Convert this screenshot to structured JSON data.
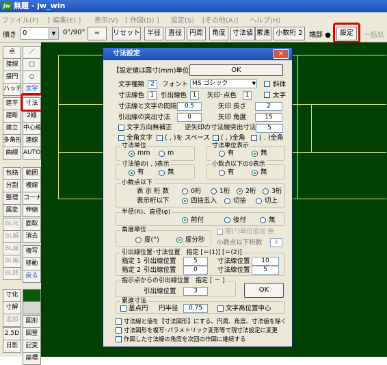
{
  "app": {
    "title": "無題 - jw_win",
    "icon": "jw"
  },
  "menu": [
    "ファイル(F)",
    "[ 編集(E) ]",
    "表示(V)",
    "[ 作図(D) ]",
    "設定(S)",
    "[その他(A)]",
    "ヘルプ(H)"
  ],
  "toolbar": {
    "angle_label": "傾き",
    "angle_value": "0",
    "rot_label": "0°/90°",
    "eq_label": "=",
    "reset": "リセット",
    "radius": "半径",
    "diameter": "直径",
    "circumference": "円周",
    "angle": "角度",
    "dim_value": "寸法値",
    "cumulative": "累進",
    "decimal": "小数桁 2",
    "endpoint": "端部 ●",
    "settings": "設定",
    "batch": "一括処"
  },
  "left_toolbar": {
    "col1": [
      "点",
      "接線",
      "接円",
      "ハッチ",
      "建平",
      "建断",
      "建立",
      "多角形",
      "曲線",
      "包絡",
      "分割",
      "整理",
      "属変",
      "BL化",
      "BL解",
      "BL属",
      "BL編",
      "BL終",
      "寸化",
      "寸解",
      "追加",
      "2.5D",
      "日影"
    ],
    "col2": [
      "／",
      "□",
      "○",
      "文字",
      "寸法",
      "2線",
      "中心線",
      "連線",
      "AUTO",
      "範囲",
      "複線",
      "コーナー",
      "伸縮",
      "面取",
      "消去",
      "複写",
      "移動",
      "戻る",
      "",
      "",
      "図形",
      "図登",
      "記変",
      "座標"
    ]
  },
  "dialog": {
    "title": "寸法設定",
    "close_label": "×",
    "unit_note": "【設定値は図寸(mm)単位】",
    "ok1": "OK",
    "ok2": "OK",
    "font_type_label": "文字種類",
    "font_type_value": "2",
    "font_label": "フォント",
    "font_value": "MS ゴシック",
    "italic_label": "斜体",
    "dim_line_color_label": "寸法線色",
    "dim_line_color_value": "1",
    "leader_color_label": "引出線色",
    "leader_color_value": "1",
    "arrow_color_label": "矢印･点色",
    "arrow_color_value": "1",
    "bold_label": "太字",
    "text_gap_label": "寸法線と文字の間隔",
    "text_gap_value": "0.5",
    "arrow_len_label": "矢印 長さ",
    "arrow_len_value": "2",
    "leader_ext_label": "引出線の突出寸法",
    "leader_ext_value": "0",
    "arrow_angle_label": "矢印 角度",
    "arrow_angle_value": "15",
    "text_dir_label": "文字方向無補正",
    "rev_arrow_label": "逆矢印の寸法線突出寸法",
    "rev_arrow_value": "5",
    "fullwidth_label": "全角文字",
    "comma_space_label": "( , )を スペース",
    "comma_full_label": "( , )全角",
    "dot_full_label": "( . )全角",
    "unit_group": {
      "title": "寸法単位",
      "opt1": "mm",
      "opt2": "m"
    },
    "unit_show_group": {
      "title": "寸法単位表示",
      "opt1": "有",
      "opt2": "無"
    },
    "comma_group": {
      "title": "寸法値の( , )表示",
      "opt1": "有",
      "opt2": "無"
    },
    "zero_group": {
      "title": "小数点以下の0表示",
      "opt1": "有",
      "opt2": "無"
    },
    "decimal_group": {
      "title": "小数点以下",
      "digits_label": "表 示 桁 数",
      "d0": "0桁",
      "d1": "1桁",
      "d2": "2桁",
      "d3": "3桁",
      "round_label": "表示桁以下",
      "r1": "四捨五入",
      "r2": "切捨",
      "r3": "切上"
    },
    "radius_group": {
      "title": "半径(R)、直径(φ)",
      "opt1": "前付",
      "opt2": "後付",
      "opt3": "無"
    },
    "angle_group": {
      "title": "角度単位",
      "opt1": "度(°)",
      "opt2": "度分秒",
      "deg_suffix_label": "度(°)単位追加 無",
      "decimals_label": "小数点以下桁数",
      "decimals_value": "4"
    },
    "pos_group": {
      "title": "引出線位置･寸法位置　指定 [＝(1)] [＝(2)]",
      "s1_label": "指定 1",
      "s2_label": "指定 2",
      "leader_label": "引出線位置",
      "dim_label": "寸法線位置",
      "s1_leader": "5",
      "s1_dim": "10",
      "s2_leader": "0",
      "s2_dim": "5"
    },
    "point_group": {
      "title": "指示点からの引出線位置　指定 [ － ]",
      "leader_label": "引出線位置",
      "value": "3"
    },
    "cum_group": {
      "title": "累進寸法",
      "base_circle": "基点円",
      "radius_label": "円半径",
      "radius_value": "0.75",
      "text_center": "文字高位置中心"
    },
    "footer": [
      "寸法線と値を【寸法図形】にする。円周、角度、寸法値を除く",
      "寸法図形を複写･パラメトリック変形等で現寸法設定に変更",
      "作図した寸法線の角度を次回の作図に継続する"
    ]
  },
  "colors": {
    "canvas": "#004000",
    "highlight": "#e00000",
    "lines": "#e8e870"
  }
}
